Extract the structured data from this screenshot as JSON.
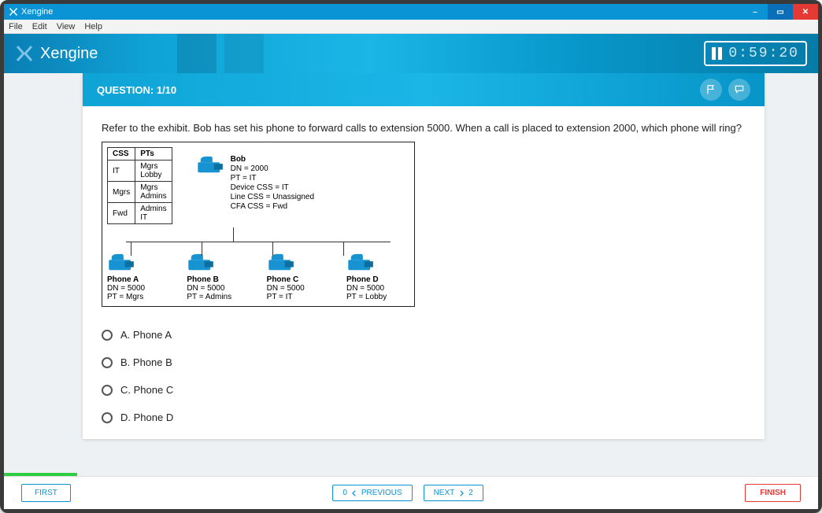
{
  "window": {
    "title": "Xengine"
  },
  "menu": {
    "file": "File",
    "edit": "Edit",
    "view": "View",
    "help": "Help"
  },
  "banner": {
    "app_name": "Xengine"
  },
  "timer": {
    "value": "0:59:20"
  },
  "question": {
    "counter_label": "QUESTION: 1/10",
    "text": "Refer to the exhibit. Bob has set his phone to forward calls to extension 5000. When a call is placed to extension 2000, which phone will ring?"
  },
  "exhibit": {
    "table": {
      "head_css": "CSS",
      "head_pts": "PTs",
      "rows": [
        {
          "css": "IT",
          "pts": "Mgrs\nLobby"
        },
        {
          "css": "Mgrs",
          "pts": "Mgrs\nAdmins"
        },
        {
          "css": "Fwd",
          "pts": "Admins\nIT"
        }
      ]
    },
    "bob": {
      "name": "Bob",
      "dn": "DN = 2000",
      "pt": "PT = IT",
      "devcss": "Device CSS = IT",
      "linecss": "Line CSS = Unassigned",
      "cfacss": "CFA CSS = Fwd"
    },
    "phones": [
      {
        "name": "Phone A",
        "dn": "DN = 5000",
        "pt": "PT = Mgrs"
      },
      {
        "name": "Phone B",
        "dn": "DN = 5000",
        "pt": "PT = Admins"
      },
      {
        "name": "Phone C",
        "dn": "DN = 5000",
        "pt": "PT = IT"
      },
      {
        "name": "Phone D",
        "dn": "DN = 5000",
        "pt": "PT = Lobby"
      }
    ]
  },
  "options": {
    "a": "A. Phone A",
    "b": "B. Phone B",
    "c": "C. Phone C",
    "d": "D. Phone D"
  },
  "footer": {
    "first": "FIRST",
    "previous": "PREVIOUS",
    "prev_num": "0",
    "next": "NEXT",
    "next_num": "2",
    "finish": "FINISH"
  }
}
